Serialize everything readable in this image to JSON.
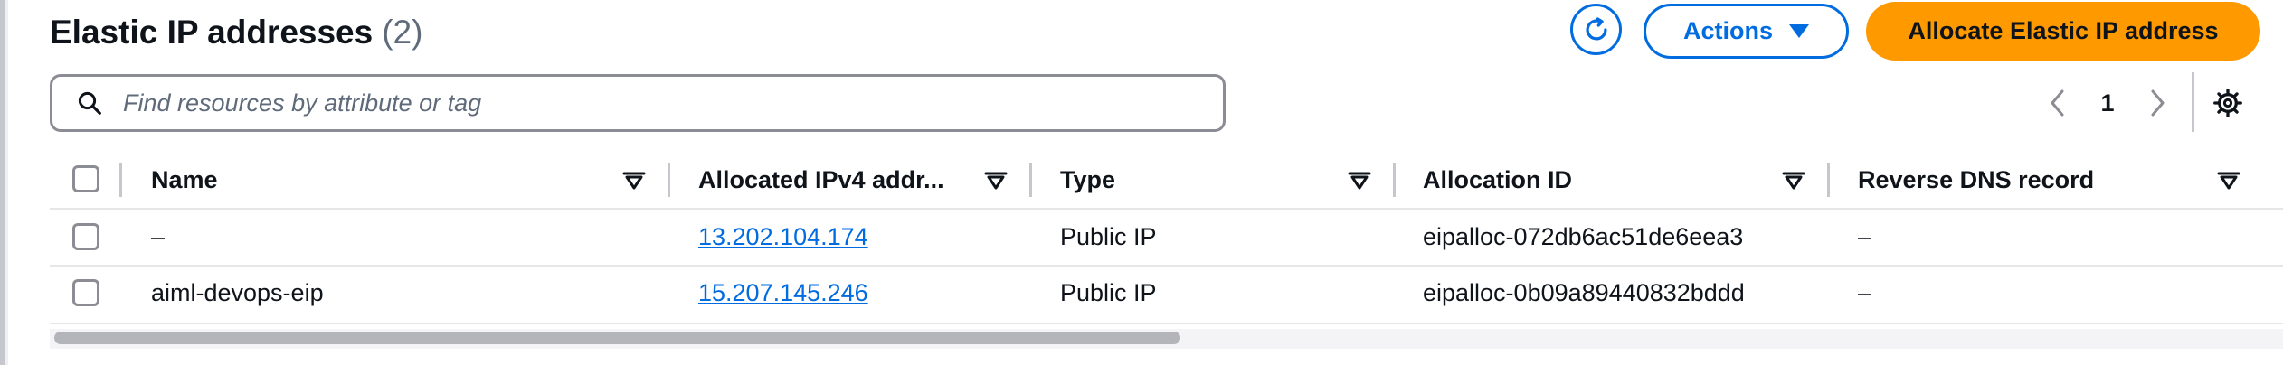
{
  "header": {
    "title": "Elastic IP addresses",
    "count": "(2)",
    "actions_label": "Actions",
    "allocate_label": "Allocate Elastic IP address"
  },
  "search": {
    "placeholder": "Find resources by attribute or tag",
    "value": ""
  },
  "pagination": {
    "current_page": "1"
  },
  "table": {
    "columns": [
      "Name",
      "Allocated IPv4 addr...",
      "Type",
      "Allocation ID",
      "Reverse DNS record"
    ],
    "rows": [
      {
        "name": "–",
        "ipv4": "13.202.104.174",
        "type": "Public IP",
        "allocation_id": "eipalloc-072db6ac51de6eea3",
        "reverse_dns": "–"
      },
      {
        "name": "aiml-devops-eip",
        "ipv4": "15.207.145.246",
        "type": "Public IP",
        "allocation_id": "eipalloc-0b09a89440832bddd",
        "reverse_dns": "–"
      }
    ]
  },
  "colors": {
    "accent": "#006ce0",
    "primary_button": "#ff9900",
    "text": "#0f141a",
    "muted_text": "#5f6b7a",
    "border": "#8c8c94"
  },
  "icons": [
    "refresh-icon",
    "caret-down-icon",
    "search-icon",
    "chevron-left-icon",
    "chevron-right-icon",
    "gear-icon",
    "sort-icon"
  ]
}
